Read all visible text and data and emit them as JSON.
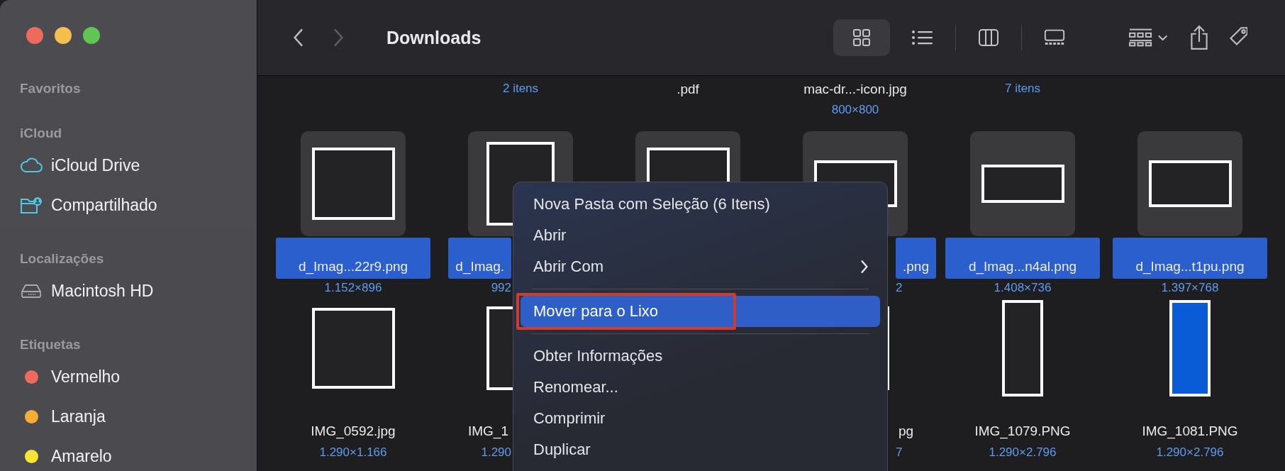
{
  "window": {
    "title": "Downloads"
  },
  "sidebar": {
    "sections": [
      {
        "header": "Favoritos"
      },
      {
        "header": "iCloud",
        "items": [
          {
            "label": "iCloud Drive"
          },
          {
            "label": "Compartilhado"
          }
        ]
      },
      {
        "header": "Localizações",
        "items": [
          {
            "label": "Macintosh HD"
          }
        ]
      },
      {
        "header": "Etiquetas",
        "items": [
          {
            "label": "Vermelho",
            "color": "#ee6a5f"
          },
          {
            "label": "Laranja",
            "color": "#f5ad36"
          },
          {
            "label": "Amarelo",
            "color": "#f7e435"
          }
        ]
      }
    ]
  },
  "toolbar": {
    "back_disabled": false,
    "forward_disabled": true,
    "views": [
      {
        "selected": true
      },
      {
        "selected": false
      },
      {
        "selected": false
      },
      {
        "selected": false
      }
    ]
  },
  "files": {
    "top_row": [
      {
        "lines": [
          {
            "kind": "info",
            "text": "2 itens"
          }
        ]
      },
      {
        "lines": [
          {
            "kind": "name",
            "text": ".pdf"
          }
        ]
      },
      {
        "lines": [
          {
            "kind": "name",
            "text": "mac-dr...-icon.jpg"
          },
          {
            "kind": "info",
            "text": "800×800"
          }
        ]
      },
      {
        "lines": [
          {
            "kind": "info",
            "text": "7 itens"
          }
        ]
      }
    ],
    "rows": [
      [
        {
          "name": "d_Imag...22r9.png",
          "info": "1.152×896",
          "selected": true
        },
        {
          "name": "d_Imag.",
          "info": "992",
          "selected": true
        },
        {
          "selected": true
        },
        {
          "name": ".png",
          "info": "2",
          "selected": true
        },
        {
          "name": "d_Imag...n4al.png",
          "info": "1.408×736",
          "selected": true
        },
        {
          "name": "d_Imag...t1pu.png",
          "info": "1.397×768",
          "selected": true
        }
      ],
      [
        {
          "name": "IMG_0592.jpg",
          "info": "1.290×1.166",
          "selected": false
        },
        {
          "name": "IMG_1",
          "info": "1.290",
          "selected": false
        },
        "",
        {
          "name": "pg",
          "info": "7",
          "selected": false
        },
        {
          "name": "IMG_1079.PNG",
          "info": "1.290×2.796",
          "selected": false
        },
        {
          "name": "IMG_1081.PNG",
          "info": "1.290×2.796",
          "selected": false,
          "color": "#0a5bd6"
        }
      ]
    ]
  },
  "context_menu": {
    "items": [
      {
        "kind": "item",
        "label": "Nova Pasta com Seleção (6 Itens)",
        "selected": false
      },
      {
        "kind": "item",
        "label": "Abrir",
        "selected": false
      },
      {
        "kind": "item",
        "label": "Abrir Com",
        "selected": false,
        "submenu": true
      },
      {
        "kind": "separator"
      },
      {
        "kind": "item",
        "label": "Mover para o Lixo",
        "selected": true,
        "outlined": true
      },
      {
        "kind": "separator"
      },
      {
        "kind": "item",
        "label": "Obter Informações",
        "selected": false
      },
      {
        "kind": "item",
        "label": "Renomear...",
        "selected": false
      },
      {
        "kind": "item",
        "label": "Comprimir",
        "selected": false
      },
      {
        "kind": "item",
        "label": "Duplicar",
        "selected": false
      }
    ]
  }
}
